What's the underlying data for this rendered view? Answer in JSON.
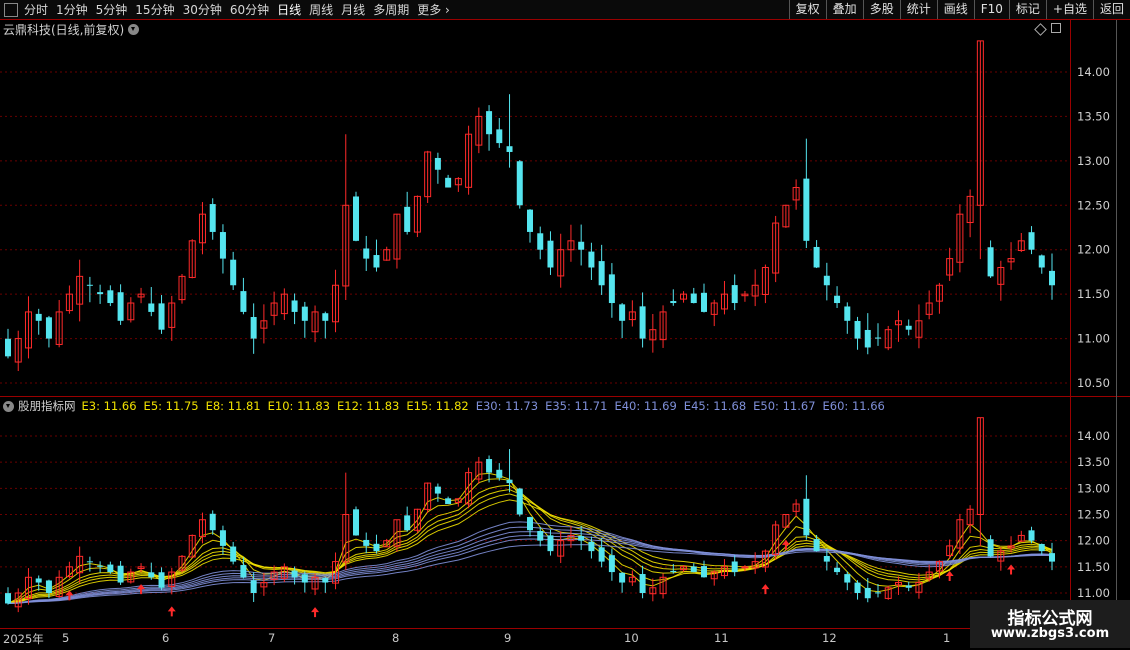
{
  "toolbar": {
    "timeframes": [
      "分时",
      "1分钟",
      "5分钟",
      "15分钟",
      "30分钟",
      "60分钟",
      "日线",
      "周线",
      "月线",
      "多周期",
      "更多"
    ],
    "active": "日线",
    "right_buttons": [
      "复权",
      "叠加",
      "多股",
      "统计",
      "画线",
      "F10",
      "标记",
      "+自选",
      "返回"
    ]
  },
  "main": {
    "title": "云鼎科技(日线,前复权)",
    "yticks": [
      "14.00",
      "13.50",
      "13.00",
      "12.50",
      "12.00",
      "11.50",
      "11.00",
      "10.50"
    ]
  },
  "indicator": {
    "name": "股朋指标网",
    "emas": [
      {
        "label": "E3",
        "value": "11.66",
        "color": "#f0e000"
      },
      {
        "label": "E5",
        "value": "11.75",
        "color": "#f0e000"
      },
      {
        "label": "E8",
        "value": "11.81",
        "color": "#f0e000"
      },
      {
        "label": "E10",
        "value": "11.83",
        "color": "#f0e000"
      },
      {
        "label": "E12",
        "value": "11.83",
        "color": "#f0e000"
      },
      {
        "label": "E15",
        "value": "11.82",
        "color": "#f0e000"
      },
      {
        "label": "E30",
        "value": "11.73",
        "color": "#7f8fd8"
      },
      {
        "label": "E35",
        "value": "11.71",
        "color": "#7f8fd8"
      },
      {
        "label": "E40",
        "value": "11.69",
        "color": "#7f8fd8"
      },
      {
        "label": "E45",
        "value": "11.68",
        "color": "#7f8fd8"
      },
      {
        "label": "E50",
        "value": "11.67",
        "color": "#7f8fd8"
      },
      {
        "label": "E60",
        "value": "11.66",
        "color": "#7f8fd8"
      }
    ],
    "yticks": [
      "14.00",
      "13.50",
      "13.00",
      "12.50",
      "12.00",
      "11.50",
      "11.00"
    ]
  },
  "xaxis": [
    "2025年",
    "5",
    "6",
    "7",
    "8",
    "9",
    "10",
    "11",
    "12",
    "1"
  ],
  "watermark": {
    "title": "指标公式网",
    "url": "www.zbgs3.com"
  },
  "colors": {
    "up": "#ff2a2a",
    "down": "#55e5ef",
    "grid": "#6a0000",
    "border": "#9a0000",
    "fast": "#f0e000",
    "slow": "#7f8fd8"
  },
  "chart_data": {
    "type": "candlestick",
    "title": "云鼎科技(日线,前复权)",
    "ylim": [
      10.4,
      14.5
    ],
    "categories": [
      "2025年",
      "5",
      "6",
      "7",
      "8",
      "9",
      "10",
      "11",
      "12",
      "1"
    ],
    "closes": [
      10.8,
      11.0,
      11.3,
      11.2,
      11.0,
      11.3,
      11.5,
      11.7,
      11.6,
      11.5,
      11.4,
      11.2,
      11.4,
      11.5,
      11.3,
      11.1,
      11.4,
      11.7,
      12.1,
      12.4,
      12.2,
      11.9,
      11.6,
      11.3,
      11.0,
      11.2,
      11.4,
      11.5,
      11.3,
      11.2,
      11.3,
      11.2,
      11.6,
      12.5,
      12.1,
      11.9,
      11.8,
      12.0,
      12.4,
      12.2,
      12.6,
      13.1,
      12.9,
      12.7,
      12.8,
      13.3,
      13.5,
      13.3,
      13.2,
      13.1,
      12.5,
      12.2,
      12.0,
      11.8,
      12.0,
      12.1,
      12.0,
      11.8,
      11.6,
      11.4,
      11.2,
      11.3,
      11.0,
      11.1,
      11.3,
      11.4,
      11.5,
      11.4,
      11.3,
      11.4,
      11.5,
      11.4,
      11.5,
      11.6,
      11.8,
      12.3,
      12.5,
      12.7,
      12.1,
      11.8,
      11.6,
      11.4,
      11.2,
      11.0,
      10.9,
      11.0,
      11.1,
      11.2,
      11.1,
      11.2,
      11.4,
      11.6,
      11.9,
      12.4,
      12.6,
      12.0,
      11.7,
      11.8,
      11.9,
      12.1,
      12.0,
      11.8,
      11.6
    ]
  }
}
